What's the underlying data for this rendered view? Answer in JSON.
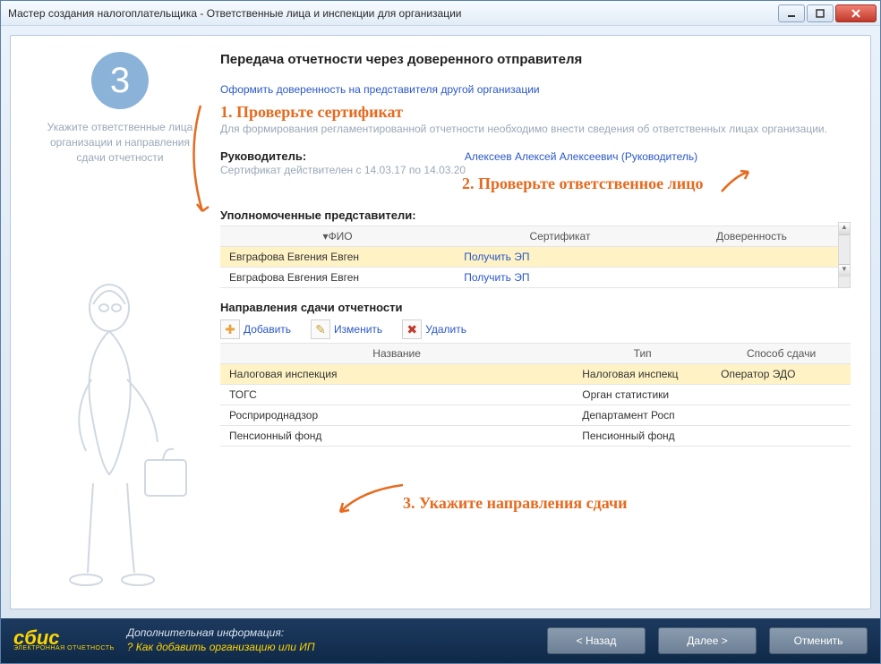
{
  "window": {
    "title": "Мастер создания налогоплательщика - Ответственные лица и инспекции для организации"
  },
  "step": {
    "number": "3",
    "hint": "Укажите ответственные лица организации и направления сдачи отчетности"
  },
  "heading": "Передача отчетности через доверенного отправителя",
  "link_delegate": "Оформить доверенность на представителя другой организации",
  "annotations": {
    "a1": "1. Проверьте сертификат",
    "a2": "2. Проверьте ответственное лицо",
    "a3": "3. Укажите направления сдачи"
  },
  "desc": "Для формирования регламентированной отчетности необходимо внести сведения об ответственных лицах организации.",
  "manager": {
    "label": "Руководитель:",
    "cert_text": "Сертификат действителен с 14.03.17 по 14.03.20",
    "person": "Алексеев Алексей Алексеевич (Руководитель)"
  },
  "reps": {
    "title": "Уполномоченные представители:",
    "cols": {
      "fio": "ФИО",
      "cert": "Сертификат",
      "doc": "Доверенность"
    },
    "get_ep": "Получить ЭП",
    "rows": [
      {
        "fio": "Евграфова Евгения Евген"
      },
      {
        "fio": "Евграфова Евгения Евген"
      }
    ]
  },
  "directions": {
    "title": "Направления сдачи отчетности",
    "toolbar": {
      "add": "Добавить",
      "edit": "Изменить",
      "del": "Удалить"
    },
    "cols": {
      "name": "Название",
      "type": "Тип",
      "method": "Способ сдачи"
    },
    "rows": [
      {
        "name": "Налоговая инспекция",
        "type": "Налоговая инспекц",
        "method": "Оператор ЭДО"
      },
      {
        "name": "ТОГС",
        "type": "Орган статистики",
        "method": ""
      },
      {
        "name": "Росприроднадзор",
        "type": "Департамент Росп",
        "method": ""
      },
      {
        "name": "Пенсионный фонд",
        "type": "Пенсионный фонд",
        "method": ""
      }
    ]
  },
  "footer": {
    "logo": "сбис",
    "logo_sub": "ЭЛЕКТРОННАЯ ОТЧЕТНОСТЬ",
    "info_label": "Дополнительная информация:",
    "info_q": "? Как добавить организацию или ИП",
    "back": "< Назад",
    "next": "Далее >",
    "cancel": "Отменить"
  }
}
